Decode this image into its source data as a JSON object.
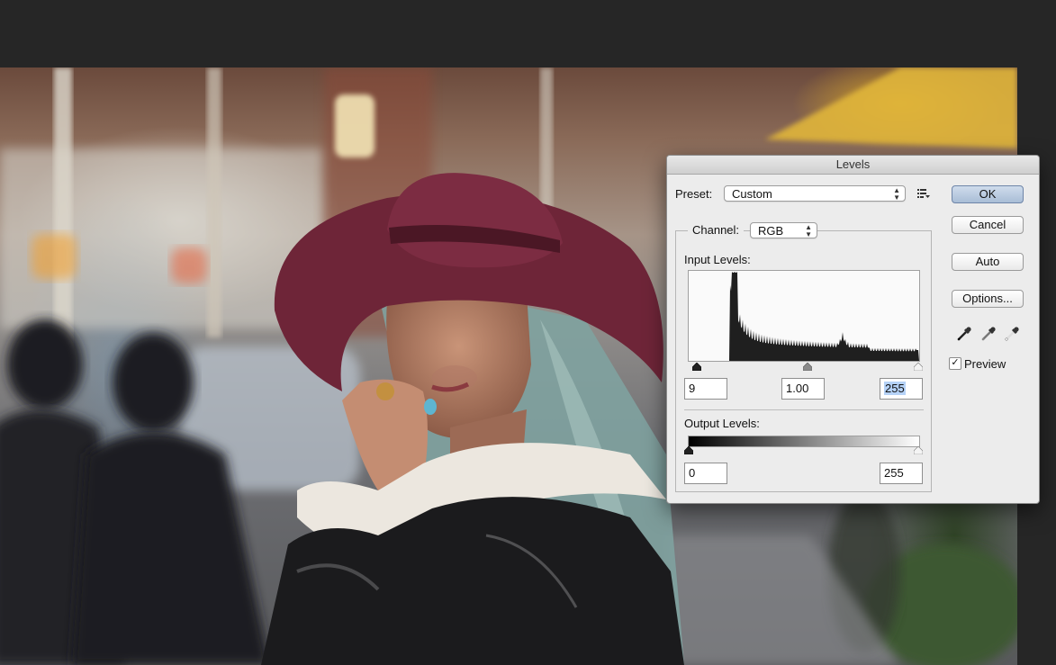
{
  "dialog": {
    "title": "Levels",
    "preset_label": "Preset:",
    "preset_value": "Custom",
    "channel_label": "Channel:",
    "channel_value": "RGB",
    "input_levels_label": "Input Levels:",
    "input_black": "9",
    "input_gamma": "1.00",
    "input_white": "255",
    "output_levels_label": "Output Levels:",
    "output_black": "0",
    "output_white": "255",
    "preview_label": "Preview",
    "preview_checked": true
  },
  "buttons": {
    "ok": "OK",
    "cancel": "Cancel",
    "auto": "Auto",
    "options": "Options..."
  },
  "icons": {
    "preset_menu": "preset-options-icon",
    "eyedropper_black": "black-point-eyedropper-icon",
    "eyedropper_gray": "gray-point-eyedropper-icon",
    "eyedropper_white": "white-point-eyedropper-icon"
  },
  "colors": {
    "default_button": "#a9bdd6",
    "histogram_fill": "#1f1f1f",
    "selection_highlight": "#b5d2f7"
  }
}
